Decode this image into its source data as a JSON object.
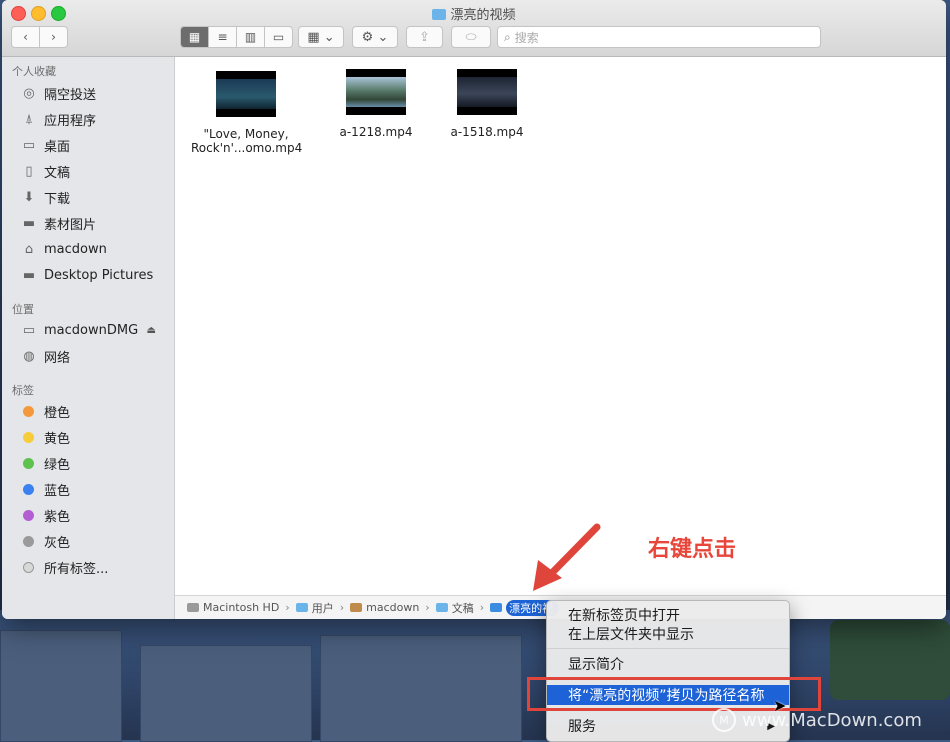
{
  "window": {
    "title": "漂亮的视频"
  },
  "toolbar": {
    "back_icon": "chevron-left-icon",
    "forward_icon": "chevron-right-icon",
    "search_placeholder": "搜索"
  },
  "sidebar": {
    "favorites_header": "个人收藏",
    "favorites": [
      {
        "label": "隔空投送",
        "icon": "airdrop-icon"
      },
      {
        "label": "应用程序",
        "icon": "applications-icon"
      },
      {
        "label": "桌面",
        "icon": "desktop-icon"
      },
      {
        "label": "文稿",
        "icon": "documents-icon"
      },
      {
        "label": "下载",
        "icon": "download-icon"
      },
      {
        "label": "素材图片",
        "icon": "folder-icon"
      },
      {
        "label": "macdown",
        "icon": "home-icon"
      },
      {
        "label": "Desktop Pictures",
        "icon": "folder-icon"
      }
    ],
    "locations_header": "位置",
    "locations": [
      {
        "label": "macdownDMG",
        "icon": "disk-icon"
      },
      {
        "label": "网络",
        "icon": "network-icon"
      }
    ],
    "tags_header": "标签",
    "tags": [
      {
        "label": "橙色",
        "color": "#f5983b"
      },
      {
        "label": "黄色",
        "color": "#f7cc3a"
      },
      {
        "label": "绿色",
        "color": "#5ec24f"
      },
      {
        "label": "蓝色",
        "color": "#3b82f0"
      },
      {
        "label": "紫色",
        "color": "#b35fd3"
      },
      {
        "label": "灰色",
        "color": "#9a9a9a"
      }
    ],
    "all_tags": "所有标签..."
  },
  "files": [
    {
      "name_line1": "\"Love, Money,",
      "name_line2": "Rock'n'...omo.mp4"
    },
    {
      "name_line1": "a-1218.mp4",
      "name_line2": ""
    },
    {
      "name_line1": "a-1518.mp4",
      "name_line2": ""
    }
  ],
  "pathbar": [
    "Macintosh HD",
    "用户",
    "macdown",
    "文稿",
    "漂亮的视"
  ],
  "context_menu": {
    "items": [
      "在新标签页中打开",
      "在上层文件夹中显示",
      "显示简介",
      "将“漂亮的视频”拷贝为路径名称",
      "服务"
    ]
  },
  "annotation": "右键点击",
  "watermark": "www.MacDown.com",
  "colors": {
    "accent": "#1d62d6",
    "annotation": "#e0453b"
  }
}
